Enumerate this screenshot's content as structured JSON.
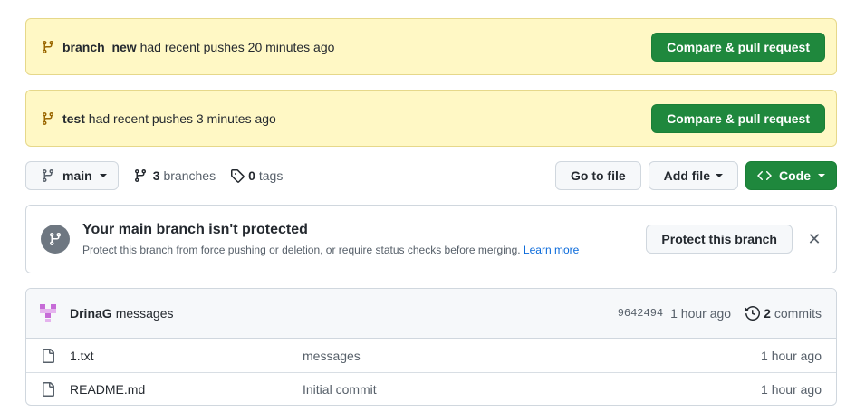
{
  "banners": [
    {
      "branch": "branch_new",
      "suffix": " had recent pushes 20 minutes ago",
      "button": "Compare & pull request"
    },
    {
      "branch": "test",
      "suffix": " had recent pushes 3 minutes ago",
      "button": "Compare & pull request"
    }
  ],
  "toolbar": {
    "branch_selector": "main",
    "branches_count": "3",
    "branches_label": "branches",
    "tags_count": "0",
    "tags_label": "tags",
    "go_to_file": "Go to file",
    "add_file": "Add file",
    "code": "Code"
  },
  "protect": {
    "title": "Your main branch isn't protected",
    "description": "Protect this branch from force pushing or deletion, or require status checks before merging.",
    "learn_more": "Learn more",
    "button": "Protect this branch"
  },
  "commit": {
    "author": "DrinaG",
    "message": "messages",
    "sha": "9642494",
    "ago": "1 hour ago",
    "commits_count": "2",
    "commits_label": "commits"
  },
  "files": [
    {
      "name": "1.txt",
      "message": "messages",
      "ago": "1 hour ago"
    },
    {
      "name": "README.md",
      "message": "Initial commit",
      "ago": "1 hour ago"
    }
  ],
  "colors": {
    "primary": "#1f883d",
    "banner": "#fff8c5",
    "link": "#0969da"
  }
}
